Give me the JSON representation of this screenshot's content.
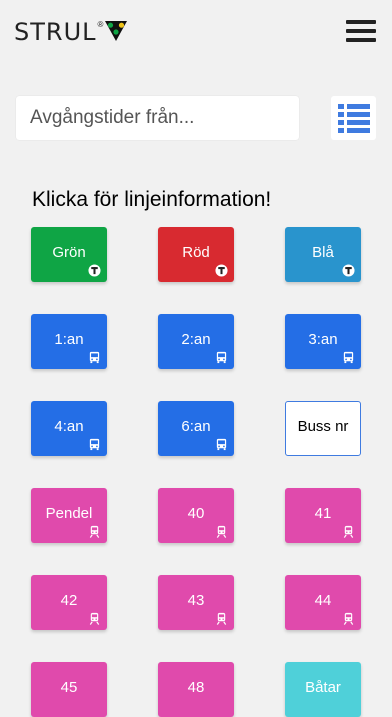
{
  "header": {
    "logo_text": "STRUL",
    "logo_reg": "®",
    "menu_icon": "hamburger-menu-icon"
  },
  "search": {
    "placeholder": "Avgångstider från...",
    "list_icon": "list-view-icon"
  },
  "section_title": "Klicka för linjeinformation!",
  "colors": {
    "green": "#0fa545",
    "red": "#d82a30",
    "lightblue": "#2994cd",
    "blue": "#246ee6",
    "pink": "#e04aac",
    "cyan": "#4fd0d9",
    "accent": "#3f7be0"
  },
  "lines": [
    {
      "label": "Grön",
      "color": "green",
      "icon": "metro-icon"
    },
    {
      "label": "Röd",
      "color": "red",
      "icon": "metro-icon"
    },
    {
      "label": "Blå",
      "color": "lightblue",
      "icon": "metro-icon"
    },
    {
      "label": "1:an",
      "color": "blue",
      "icon": "bus-icon"
    },
    {
      "label": "2:an",
      "color": "blue",
      "icon": "bus-icon"
    },
    {
      "label": "3:an",
      "color": "blue",
      "icon": "bus-icon"
    },
    {
      "label": "4:an",
      "color": "blue",
      "icon": "bus-icon"
    },
    {
      "label": "6:an",
      "color": "blue",
      "icon": "bus-icon"
    },
    {
      "label": "Buss nr",
      "color": "white",
      "icon": ""
    },
    {
      "label": "Pendel",
      "color": "pink",
      "icon": "train-icon"
    },
    {
      "label": "40",
      "color": "pink",
      "icon": "train-icon"
    },
    {
      "label": "41",
      "color": "pink",
      "icon": "train-icon"
    },
    {
      "label": "42",
      "color": "pink",
      "icon": "train-icon"
    },
    {
      "label": "43",
      "color": "pink",
      "icon": "train-icon"
    },
    {
      "label": "44",
      "color": "pink",
      "icon": "train-icon"
    },
    {
      "label": "45",
      "color": "pink",
      "icon": ""
    },
    {
      "label": "48",
      "color": "pink",
      "icon": ""
    },
    {
      "label": "Båtar",
      "color": "cyan",
      "icon": ""
    }
  ]
}
